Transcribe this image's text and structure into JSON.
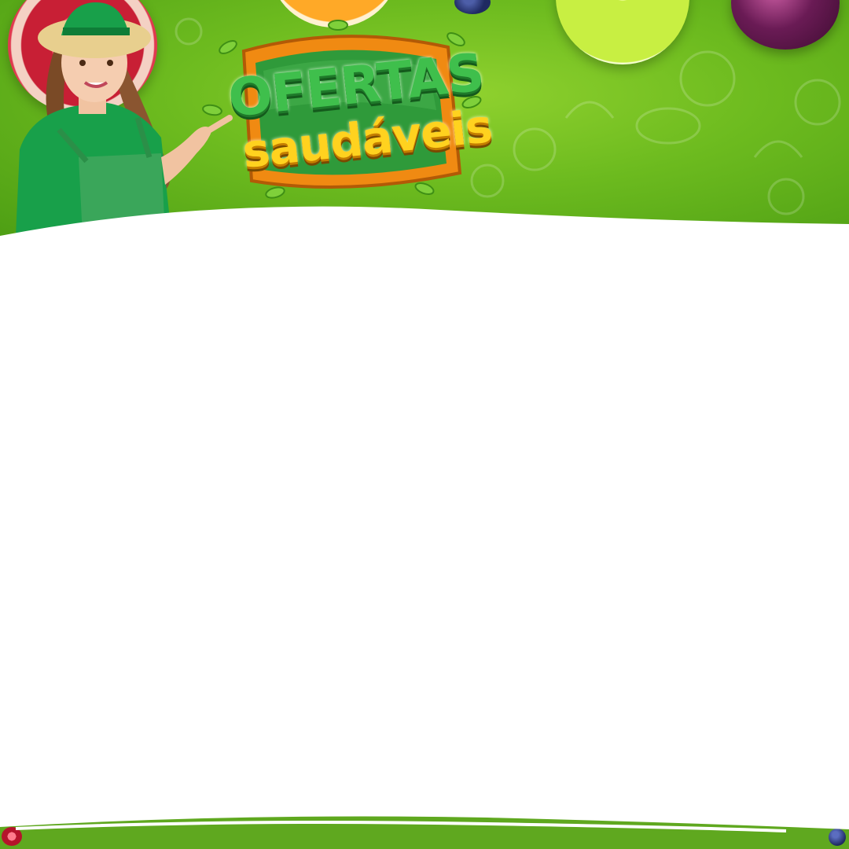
{
  "logo": {
    "line1": "OFERTAS",
    "line2": "saudáveis"
  },
  "colors": {
    "banner_green": "#6dbb1f",
    "footer_green": "#5fa81f",
    "logo_green": "#3fbf4c",
    "logo_yellow": "#ffd21f",
    "logo_orange_frame": "#f08a12"
  },
  "icons": {
    "person": "woman-gardener-illustration",
    "fruits": [
      "pomegranate",
      "orange-slice",
      "blueberry",
      "lime-slice",
      "plum"
    ]
  }
}
